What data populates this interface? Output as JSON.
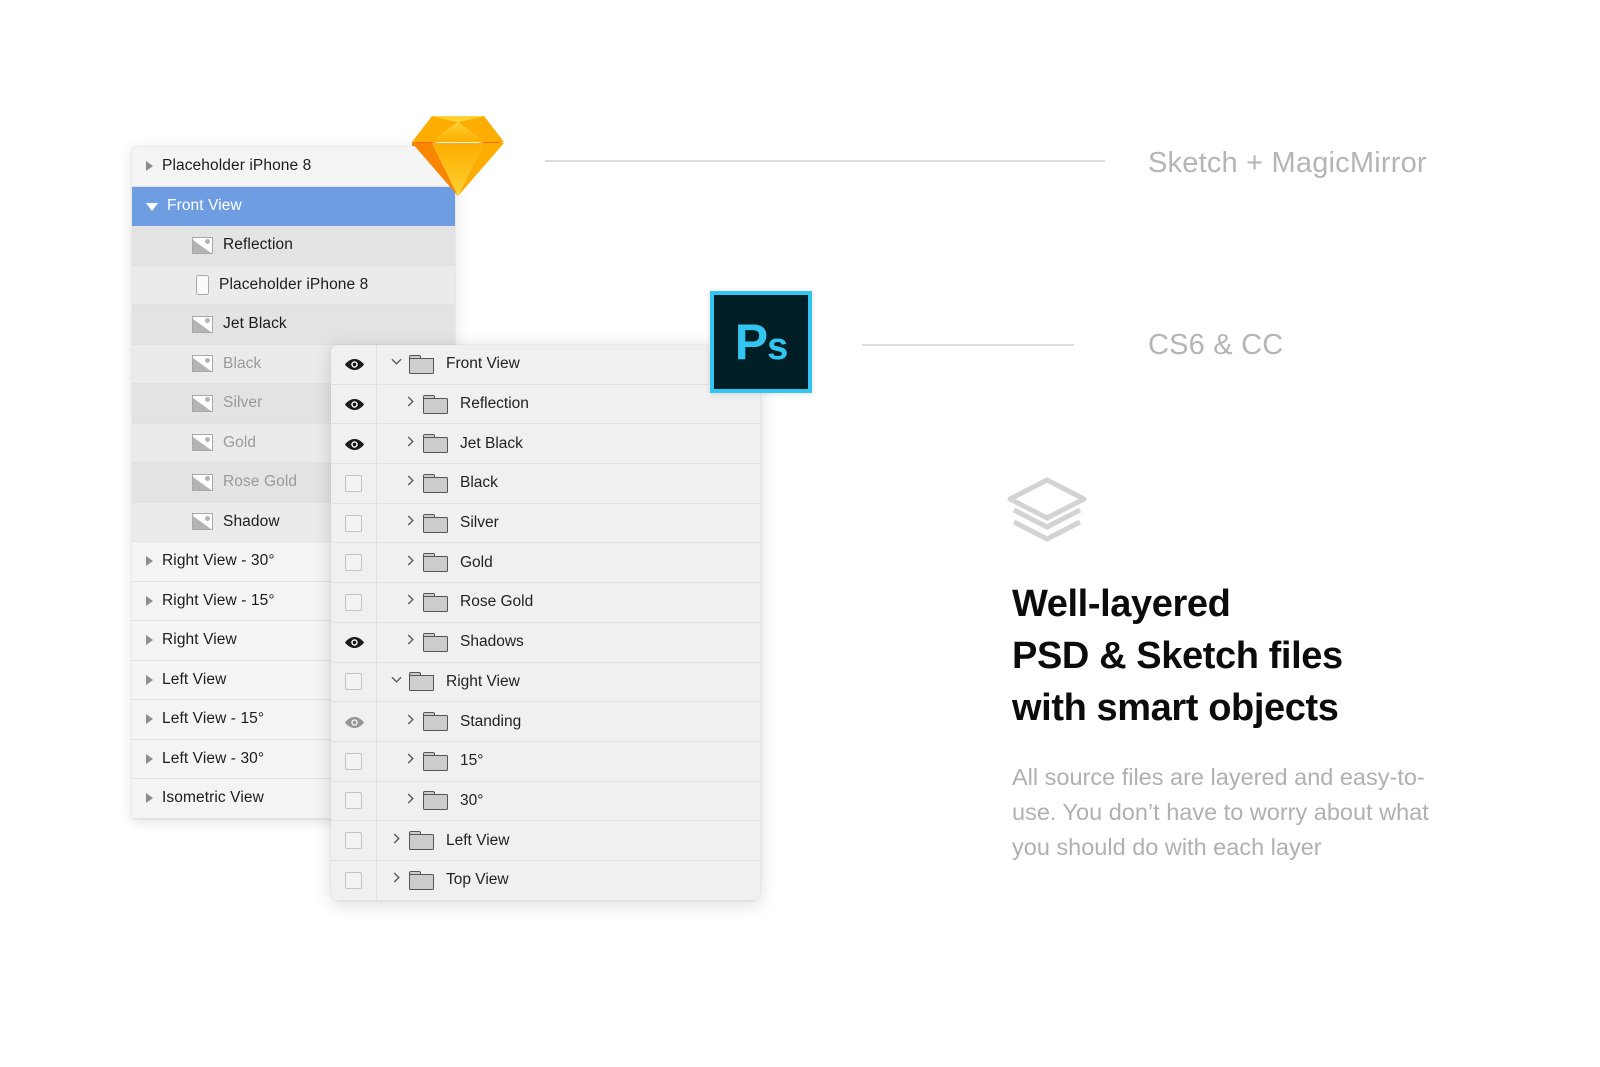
{
  "sketch_panel": {
    "name": "sketch-layers-panel",
    "rows": [
      {
        "label": "Placeholder iPhone 8",
        "icon": "triangle-right-icon",
        "indent": 0,
        "state": "collapsed",
        "style": "alt",
        "dim": false,
        "selected": false
      },
      {
        "label": "Front View",
        "icon": "triangle-down-icon",
        "indent": 0,
        "state": "expanded",
        "style": "selected",
        "dim": false,
        "selected": true
      },
      {
        "label": "Reflection",
        "icon": "bitmap-icon",
        "indent": 1,
        "state": "leaf",
        "style": "child-b",
        "dim": false,
        "selected": false
      },
      {
        "label": "Placeholder iPhone 8",
        "icon": "symbol-icon",
        "indent": 1,
        "state": "leaf",
        "style": "child-a",
        "dim": false,
        "selected": false
      },
      {
        "label": "Jet Black",
        "icon": "bitmap-icon",
        "indent": 1,
        "state": "leaf",
        "style": "child-b",
        "dim": false,
        "selected": false
      },
      {
        "label": "Black",
        "icon": "bitmap-icon",
        "indent": 1,
        "state": "leaf",
        "style": "child-a",
        "dim": true,
        "selected": false
      },
      {
        "label": "Silver",
        "icon": "bitmap-icon",
        "indent": 1,
        "state": "leaf",
        "style": "child-b",
        "dim": true,
        "selected": false
      },
      {
        "label": "Gold",
        "icon": "bitmap-icon",
        "indent": 1,
        "state": "leaf",
        "style": "child-a",
        "dim": true,
        "selected": false
      },
      {
        "label": "Rose Gold",
        "icon": "bitmap-icon",
        "indent": 1,
        "state": "leaf",
        "style": "child-b",
        "dim": true,
        "selected": false
      },
      {
        "label": "Shadow",
        "icon": "bitmap-icon",
        "indent": 1,
        "state": "leaf",
        "style": "child-a",
        "dim": false,
        "selected": false
      },
      {
        "label": "Right View - 30°",
        "icon": "triangle-right-icon",
        "indent": 0,
        "state": "collapsed",
        "style": "alt",
        "dim": false,
        "selected": false
      },
      {
        "label": "Right View - 15°",
        "icon": "triangle-right-icon",
        "indent": 0,
        "state": "collapsed",
        "style": "alt",
        "dim": false,
        "selected": false
      },
      {
        "label": "Right View",
        "icon": "triangle-right-icon",
        "indent": 0,
        "state": "collapsed",
        "style": "alt",
        "dim": false,
        "selected": false
      },
      {
        "label": "Left View",
        "icon": "triangle-right-icon",
        "indent": 0,
        "state": "collapsed",
        "style": "alt",
        "dim": false,
        "selected": false
      },
      {
        "label": "Left View - 15°",
        "icon": "triangle-right-icon",
        "indent": 0,
        "state": "collapsed",
        "style": "alt",
        "dim": false,
        "selected": false
      },
      {
        "label": "Left View - 30°",
        "icon": "triangle-right-icon",
        "indent": 0,
        "state": "collapsed",
        "style": "alt",
        "dim": false,
        "selected": false
      },
      {
        "label": "Isometric View",
        "icon": "triangle-right-icon",
        "indent": 0,
        "state": "collapsed",
        "style": "alt",
        "dim": false,
        "selected": false
      }
    ]
  },
  "photoshop_panel": {
    "name": "photoshop-layers-panel",
    "rows": [
      {
        "label": "Front View",
        "visible": true,
        "eye_faded": false,
        "indent": 0,
        "expanded": true
      },
      {
        "label": "Reflection",
        "visible": true,
        "eye_faded": false,
        "indent": 1,
        "expanded": false
      },
      {
        "label": "Jet Black",
        "visible": true,
        "eye_faded": false,
        "indent": 1,
        "expanded": false
      },
      {
        "label": "Black",
        "visible": false,
        "eye_faded": false,
        "indent": 1,
        "expanded": false
      },
      {
        "label": "Silver",
        "visible": false,
        "eye_faded": false,
        "indent": 1,
        "expanded": false
      },
      {
        "label": "Gold",
        "visible": false,
        "eye_faded": false,
        "indent": 1,
        "expanded": false
      },
      {
        "label": "Rose Gold",
        "visible": false,
        "eye_faded": false,
        "indent": 1,
        "expanded": false
      },
      {
        "label": "Shadows",
        "visible": true,
        "eye_faded": false,
        "indent": 1,
        "expanded": false
      },
      {
        "label": "Right View",
        "visible": false,
        "eye_faded": false,
        "indent": 0,
        "expanded": true
      },
      {
        "label": "Standing",
        "visible": true,
        "eye_faded": true,
        "indent": 1,
        "expanded": false
      },
      {
        "label": "15°",
        "visible": false,
        "eye_faded": false,
        "indent": 1,
        "expanded": false
      },
      {
        "label": "30°",
        "visible": false,
        "eye_faded": false,
        "indent": 1,
        "expanded": false
      },
      {
        "label": "Left View",
        "visible": false,
        "eye_faded": false,
        "indent": 0,
        "expanded": false
      },
      {
        "label": "Top View",
        "visible": false,
        "eye_faded": false,
        "indent": 0,
        "expanded": false
      }
    ]
  },
  "callouts": {
    "sketch_label": "Sketch + MagicMirror",
    "photoshop_label": "CS6 & CC"
  },
  "logos": {
    "sketch_alt": "sketch-diamond-logo",
    "photoshop_text_p": "P",
    "photoshop_text_s": "s"
  },
  "copy": {
    "headline_line1": "Well-layered",
    "headline_line2": "PSD & Sketch files",
    "headline_line3": "with smart objects",
    "body": "All source files are layered and easy-to-use. You don’t have to worry about what you should do with each layer"
  },
  "colors": {
    "selection_blue": "#6e9de2",
    "sketch_orange": "#f7a600",
    "photoshop_cyan": "#31c5f0",
    "photoshop_dark": "#001e26",
    "muted_gray": "#b5b5b5",
    "panel_bg": "#efefef"
  }
}
